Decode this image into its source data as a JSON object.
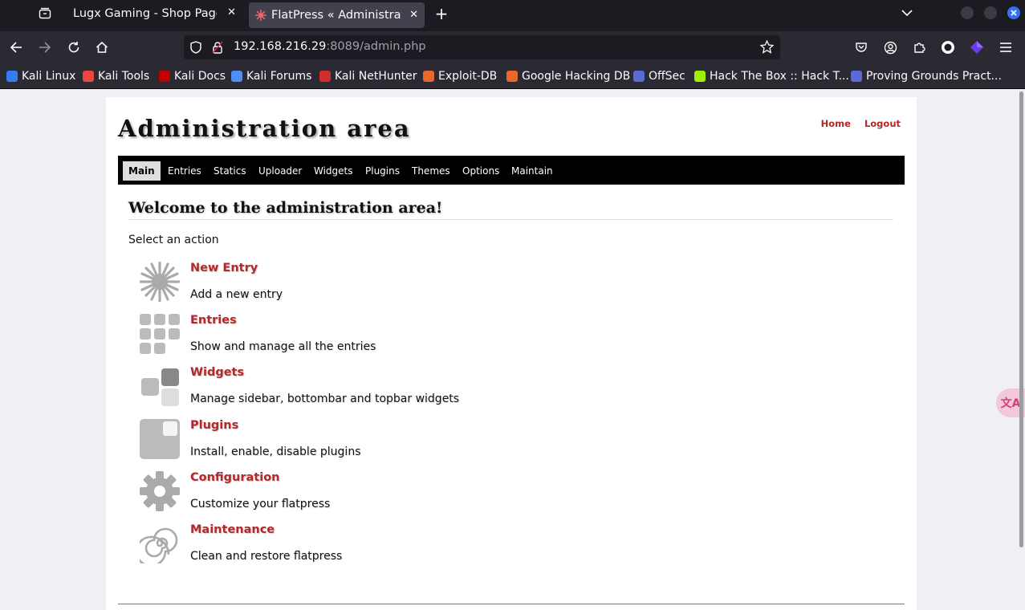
{
  "browser": {
    "tabs": [
      {
        "title": "Lugx Gaming - Shop Page",
        "active": false
      },
      {
        "title": "FlatPress « Administration",
        "active": true
      }
    ],
    "new_tab": "+",
    "url": {
      "host": "192.168.216.29",
      "rest": ":8089/admin.php"
    },
    "bookmarks": [
      {
        "label": "Kali Linux",
        "color": "#367bf0"
      },
      {
        "label": "Kali Tools",
        "color": "#e8483f"
      },
      {
        "label": "Kali Docs",
        "color": "#c00000"
      },
      {
        "label": "Kali Forums",
        "color": "#4f8ff7"
      },
      {
        "label": "Kali NetHunter",
        "color": "#d12d2d"
      },
      {
        "label": "Exploit-DB",
        "color": "#e8672b"
      },
      {
        "label": "Google Hacking DB",
        "color": "#e8672b"
      },
      {
        "label": "OffSec",
        "color": "#5b6bd6"
      },
      {
        "label": "Hack The Box :: Hack T...",
        "color": "#9fef00"
      },
      {
        "label": "Proving Grounds Pract...",
        "color": "#5b6bd6"
      }
    ]
  },
  "page": {
    "title": "Administration area",
    "links": {
      "home": "Home",
      "logout": "Logout"
    },
    "menu": [
      "Main",
      "Entries",
      "Statics",
      "Uploader",
      "Widgets",
      "Plugins",
      "Themes",
      "Options",
      "Maintain"
    ],
    "active_menu": "Main",
    "welcome": "Welcome to the administration area!",
    "subtitle": "Select an action",
    "actions": [
      {
        "label": "New Entry",
        "desc": "Add a new entry",
        "icon": "star-burst-icon"
      },
      {
        "label": "Entries",
        "desc": "Show and manage all the entries",
        "icon": "grid-icon"
      },
      {
        "label": "Widgets",
        "desc": "Manage sidebar, bottombar and topbar widgets",
        "icon": "blocks-icon"
      },
      {
        "label": "Plugins",
        "desc": "Install, enable, disable plugins",
        "icon": "plugin-icon"
      },
      {
        "label": "Configuration",
        "desc": "Customize your flatpress",
        "icon": "gear-icon"
      },
      {
        "label": "Maintenance",
        "desc": "Clean and restore flatpress",
        "icon": "spiral-icon"
      }
    ]
  },
  "colors": {
    "link": "#b5282a",
    "menu_bg": "#000000",
    "chrome_dark": "#1c1b22",
    "chrome": "#2b2a33"
  }
}
